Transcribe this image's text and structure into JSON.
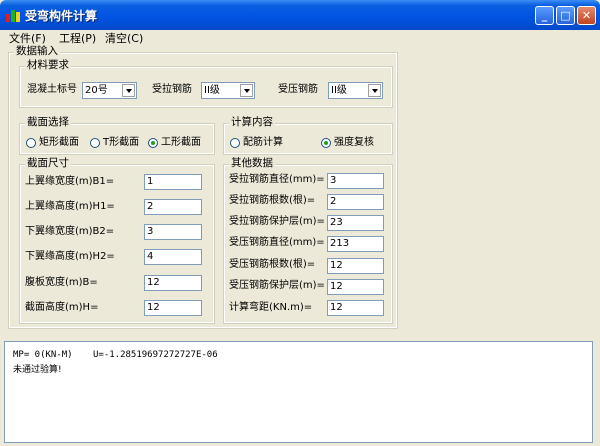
{
  "window": {
    "title": "受弯构件计算",
    "minimize": "_",
    "maximize": "□",
    "close": "✕"
  },
  "menu": [
    {
      "label": "文件(F)"
    },
    {
      "label": "工程(P)"
    },
    {
      "label": "清空(C)"
    }
  ],
  "input_group": {
    "legend": "数据输入"
  },
  "material": {
    "legend": "材料要求",
    "concrete_label": "混凝土标号",
    "concrete_value": "20号",
    "tension_label": "受拉钢筋",
    "tension_value": "II级",
    "compression_label": "受压钢筋",
    "compression_value": "II级"
  },
  "section_type": {
    "legend": "截面选择",
    "options": [
      {
        "label": "矩形截面",
        "checked": false
      },
      {
        "label": "T形截面",
        "checked": false
      },
      {
        "label": "工形截面",
        "checked": true
      }
    ]
  },
  "calc": {
    "legend": "计算内容",
    "options": [
      {
        "label": "配筋计算",
        "checked": false
      },
      {
        "label": "强度复核",
        "checked": true
      }
    ]
  },
  "dims": {
    "legend": "截面尺寸",
    "fields": [
      {
        "label": "上翼缘宽度(m)B1=",
        "value": "1"
      },
      {
        "label": "上翼缘高度(m)H1=",
        "value": "2"
      },
      {
        "label": "下翼缘宽度(m)B2=",
        "value": "3"
      },
      {
        "label": "下翼缘高度(m)H2=",
        "value": "4"
      },
      {
        "label": "腹板宽度(m)B=",
        "value": "12"
      },
      {
        "label": "截面高度(m)H=",
        "value": "12"
      }
    ]
  },
  "other": {
    "legend": "其他数据",
    "fields": [
      {
        "label": "受拉钢筋直径(mm)=",
        "value": "3"
      },
      {
        "label": "受拉钢筋根数(根)=",
        "value": "2"
      },
      {
        "label": "受拉钢筋保护层(m)=",
        "value": "23"
      },
      {
        "label": "受压钢筋直径(mm)=",
        "value": "213"
      },
      {
        "label": "受压钢筋根数(根)=",
        "value": "12"
      },
      {
        "label": "受压钢筋保护层(m)=",
        "value": "12"
      },
      {
        "label": "计算弯距(KN.m)=",
        "value": "12"
      }
    ]
  },
  "output": {
    "line1a": "MP= 0(KN-M)",
    "line1b": "U=-1.28519697272727E-06",
    "line2": "未通过验算!"
  }
}
